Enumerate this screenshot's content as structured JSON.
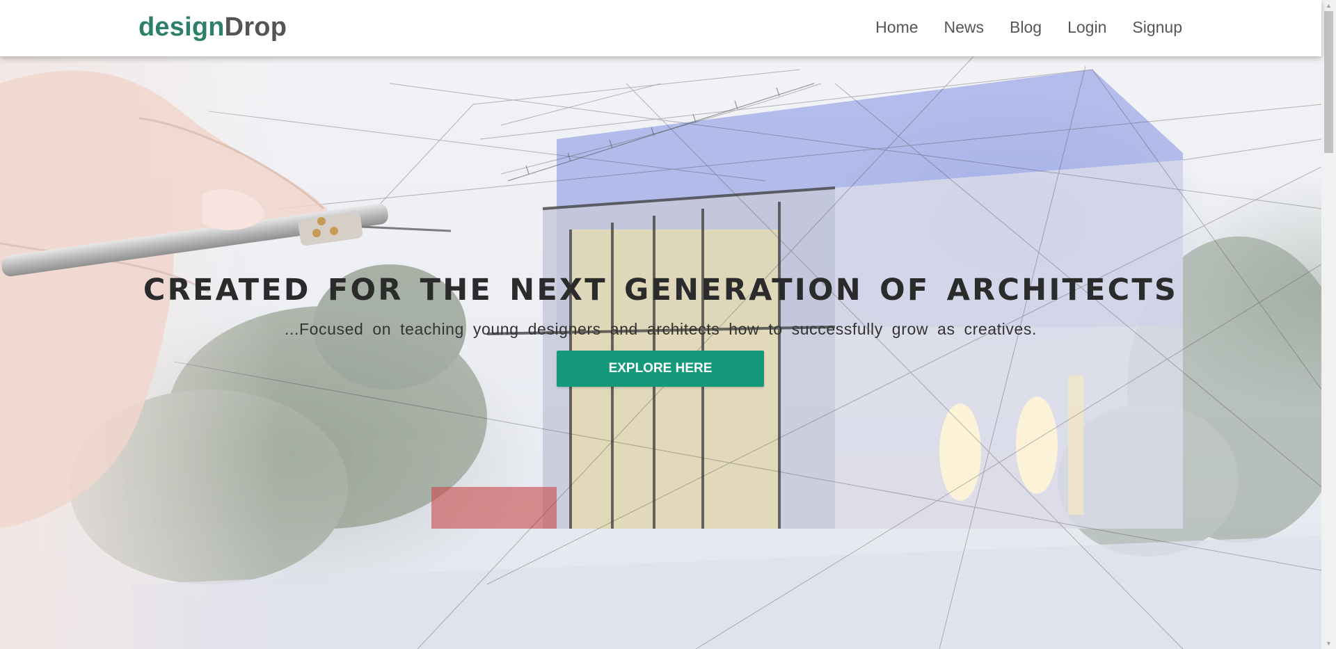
{
  "brand": {
    "part1": "design",
    "part2": "Drop"
  },
  "nav": {
    "items": [
      "Home",
      "News",
      "Blog",
      "Login",
      "Signup"
    ]
  },
  "hero": {
    "headline": "CREATED FOR THE NEXT GENERATION OF ARCHITECTS",
    "subheadline": "...Focused on teaching young designers and architects how to successfully grow as creatives.",
    "cta_label": "EXPLORE HERE"
  },
  "colors": {
    "brand_green": "#2e7f6a",
    "brand_gray": "#545454",
    "cta_background": "#149a7a",
    "nav_text": "#555555"
  },
  "icons": [
    "scroll-up-icon",
    "scroll-down-icon"
  ]
}
